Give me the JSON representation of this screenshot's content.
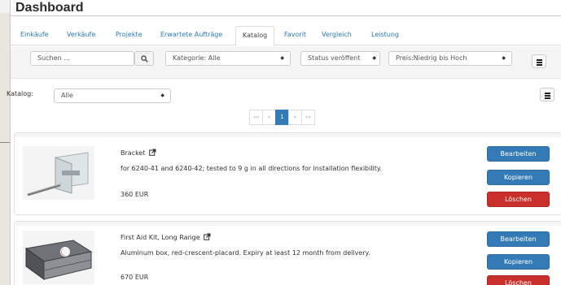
{
  "header": {
    "title": "Dashboard"
  },
  "tabs": [
    {
      "label": "Einkäufe"
    },
    {
      "label": "Verkäufe"
    },
    {
      "label": "Projekte"
    },
    {
      "label": "Erwartete Aufträge"
    },
    {
      "label": "Katalog",
      "active": true
    },
    {
      "label": "Favorit"
    },
    {
      "label": "Vergleich"
    },
    {
      "label": "Leistung"
    }
  ],
  "filters": {
    "search_placeholder": "Suchen ...",
    "category": "Kategorie: Alle",
    "status": "Status veröffent",
    "sort": "Preis:Niedrig bis Hoch"
  },
  "catalog": {
    "label": "Katalog:",
    "value": "Alle"
  },
  "pagination": {
    "first": "««",
    "prev": "«",
    "current": "1",
    "next": "»",
    "last": "»»"
  },
  "products": [
    {
      "title": "Bracket",
      "description": "for 6240-41 and 6240-42; tested to 9 g in all directions for installation flexibility.",
      "price": "360 EUR",
      "edit": "Bearbeiten",
      "copy": "Kopieren",
      "delete": "Löschen"
    },
    {
      "title": "First Aid Kit, Long Range",
      "description": "Aluminum box, red-crescent-placard. Expiry at least 12 month from delivery.",
      "price": "670 EUR",
      "edit": "Bearbeiten",
      "copy": "Kopieren",
      "delete": "Löschen"
    }
  ],
  "colors": {
    "primary": "#337ab7",
    "danger": "#c9302c",
    "link": "#2a7ab8"
  }
}
